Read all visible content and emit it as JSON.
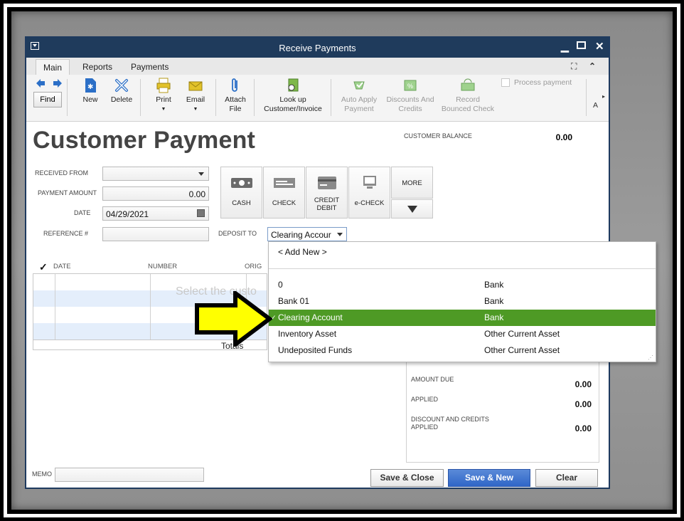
{
  "window": {
    "title": "Receive Payments"
  },
  "tabs": [
    "Main",
    "Reports",
    "Payments"
  ],
  "toolbar": {
    "find": "Find",
    "new": "New",
    "delete": "Delete",
    "print": "Print",
    "email": "Email",
    "attach_1": "Attach",
    "attach_2": "File",
    "lookup_1": "Look up",
    "lookup_2": "Customer/Invoice",
    "autoapply_1": "Auto Apply",
    "autoapply_2": "Payment",
    "discounts_1": "Discounts And",
    "discounts_2": "Credits",
    "record_1": "Record",
    "record_2": "Bounced Check",
    "process_payment": "Process payment",
    "overflow": "A"
  },
  "page": {
    "heading": "Customer Payment",
    "customer_balance_label": "CUSTOMER BALANCE",
    "customer_balance_value": "0.00"
  },
  "form": {
    "received_from_label": "RECEIVED FROM",
    "payment_amount_label": "PAYMENT AMOUNT",
    "payment_amount_value": "0.00",
    "date_label": "DATE",
    "date_value": "04/29/2021",
    "reference_label": "REFERENCE #",
    "deposit_to_label": "DEPOSIT TO",
    "deposit_to_value": "Clearing Accour"
  },
  "payment_methods": {
    "cash": "CASH",
    "check": "CHECK",
    "credit_1": "CREDIT",
    "credit_2": "DEBIT",
    "echeck": "e-CHECK",
    "more": "MORE"
  },
  "grid": {
    "col_date": "DATE",
    "col_number": "NUMBER",
    "col_orig": "ORIG",
    "placeholder": "Select the custo",
    "totals": "Totals"
  },
  "dropdown": {
    "add_new": "< Add New >",
    "items": [
      {
        "name": "0",
        "type": "Bank"
      },
      {
        "name": "Bank 01",
        "type": "Bank"
      },
      {
        "name": "Clearing Account",
        "type": "Bank"
      },
      {
        "name": "Inventory Asset",
        "type": "Other Current Asset"
      },
      {
        "name": "Undeposited Funds",
        "type": "Other Current Asset"
      }
    ],
    "selected_index": 2,
    "check_mark": "✓"
  },
  "summary": {
    "amount_due_label": "AMOUNT DUE",
    "amount_due_value": "0.00",
    "applied_label": "APPLIED",
    "applied_value": "0.00",
    "discount_label_1": "DISCOUNT AND CREDITS",
    "discount_label_2": "APPLIED",
    "discount_value": "0.00"
  },
  "footer": {
    "memo_label": "MEMO",
    "save_close": "Save & Close",
    "save_new": "Save & New",
    "clear": "Clear"
  },
  "colors": {
    "titlebar": "#1f3b5c",
    "selection": "#4e9a25",
    "arrow": "#ffff00",
    "primary_button": "#2f66c7"
  }
}
